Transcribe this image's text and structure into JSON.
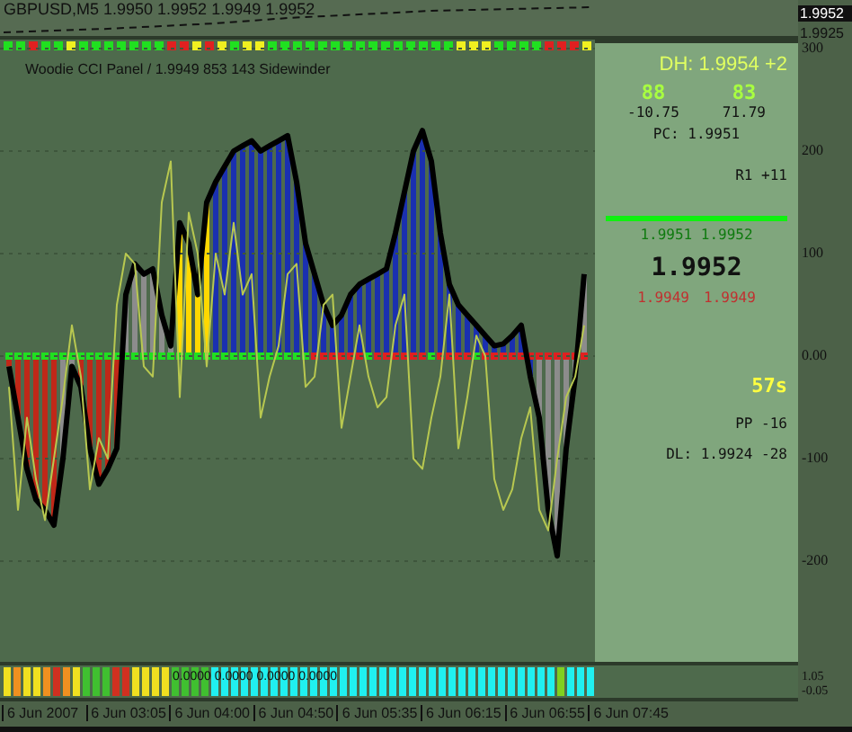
{
  "price_panel": {
    "title": "GBPUSD,M5  1.9950 1.9952 1.9949 1.9952",
    "scale": [
      {
        "label": "1.9952",
        "selected": true
      },
      {
        "label": "1.9925",
        "selected": false
      }
    ]
  },
  "indicator_label": "Woodie CCI Panel / 1.9949 853 143  Sidewinder",
  "trend_dots": [
    {
      "color": "#20e020"
    },
    {
      "color": "#20e020"
    },
    {
      "color": "#e02020"
    },
    {
      "color": "#20e020"
    },
    {
      "color": "#20e020"
    },
    {
      "color": "#f0f020"
    },
    {
      "color": "#20e020"
    },
    {
      "color": "#20e020"
    },
    {
      "color": "#20e020"
    },
    {
      "color": "#20e020"
    },
    {
      "color": "#20e020"
    },
    {
      "color": "#20e020"
    },
    {
      "color": "#20e020"
    },
    {
      "color": "#e02020"
    },
    {
      "color": "#e02020"
    },
    {
      "color": "#f0f020"
    },
    {
      "color": "#e02020"
    },
    {
      "color": "#f0f020"
    },
    {
      "color": "#20e020"
    },
    {
      "color": "#f0f020"
    },
    {
      "color": "#f0f020"
    },
    {
      "color": "#20e020"
    },
    {
      "color": "#20e020"
    },
    {
      "color": "#20e020"
    },
    {
      "color": "#20e020"
    },
    {
      "color": "#20e020"
    },
    {
      "color": "#20e020"
    },
    {
      "color": "#20e020"
    },
    {
      "color": "#20e020"
    },
    {
      "color": "#20e020"
    },
    {
      "color": "#20e020"
    },
    {
      "color": "#20e020"
    },
    {
      "color": "#20e020"
    },
    {
      "color": "#20e020"
    },
    {
      "color": "#20e020"
    },
    {
      "color": "#20e020"
    },
    {
      "color": "#f0f020"
    },
    {
      "color": "#f0f020"
    },
    {
      "color": "#f0f020"
    },
    {
      "color": "#20e020"
    },
    {
      "color": "#20e020"
    },
    {
      "color": "#20e020"
    },
    {
      "color": "#20e020"
    },
    {
      "color": "#e02020"
    },
    {
      "color": "#e02020"
    },
    {
      "color": "#e02020"
    },
    {
      "color": "#f0f020"
    }
  ],
  "chart_data": {
    "type": "line",
    "grid": true,
    "ylim": [
      -300,
      300
    ],
    "yticks": [
      300,
      200,
      100,
      {
        "value": 0,
        "label": "0.00"
      },
      -100,
      -200
    ],
    "series": [
      {
        "color": "#000000",
        "values": [
          -10,
          -60,
          -110,
          -140,
          -150,
          -165,
          -100,
          -10,
          -30,
          -90,
          -125,
          -110,
          -90,
          60,
          90,
          80,
          85,
          40,
          10,
          130,
          110,
          60,
          150,
          170,
          185,
          200,
          205,
          210,
          200,
          205,
          210,
          215,
          170,
          110,
          80,
          50,
          30,
          40,
          60,
          70,
          75,
          80,
          85,
          120,
          160,
          200,
          220,
          190,
          120,
          70,
          50,
          40,
          30,
          20,
          10,
          12,
          20,
          30,
          -20,
          -60,
          -150,
          -195,
          -90,
          -20,
          80
        ]
      },
      {
        "color": "#b8c850",
        "values": [
          -30,
          -150,
          -60,
          -120,
          -160,
          -100,
          -40,
          30,
          -20,
          -130,
          -80,
          -100,
          50,
          100,
          90,
          -10,
          -20,
          150,
          190,
          -40,
          140,
          100,
          -10,
          100,
          60,
          130,
          60,
          80,
          -60,
          -20,
          10,
          80,
          90,
          -30,
          -20,
          50,
          60,
          -70,
          -20,
          30,
          -20,
          -50,
          -40,
          30,
          60,
          -100,
          -110,
          -60,
          -20,
          60,
          -90,
          -40,
          20,
          0,
          -120,
          -150,
          -130,
          -80,
          -50,
          -150,
          -170,
          -100,
          -40,
          -20,
          30
        ]
      }
    ]
  },
  "histogram": [
    {
      "color": "#c02818"
    },
    {
      "color": "#c02818"
    },
    {
      "color": "#c02818"
    },
    {
      "color": "#c02818"
    },
    {
      "color": "#c02818"
    },
    {
      "color": "#c02818"
    },
    {
      "color": "#8c8c8c"
    },
    {
      "color": "#8c8c8c"
    },
    {
      "color": "#c02818"
    },
    {
      "color": "#c02818"
    },
    {
      "color": "#c02818"
    },
    {
      "color": "#c02818"
    },
    {
      "color": "#c02818"
    },
    {
      "color": "#8c8c8c"
    },
    {
      "color": "#8c8c8c"
    },
    {
      "color": "#8c8c8c"
    },
    {
      "color": "#8c8c8c"
    },
    {
      "color": "#8c8c8c"
    },
    {
      "color": "#8c8c8c"
    },
    {
      "color": "#ffd800"
    },
    {
      "color": "#ffd800"
    },
    {
      "color": "#ffd800"
    },
    {
      "color": "#ffd800"
    },
    {
      "color": "#1a30b0"
    },
    {
      "color": "#1a30b0"
    },
    {
      "color": "#1a30b0"
    },
    {
      "color": "#1a30b0"
    },
    {
      "color": "#1a30b0"
    },
    {
      "color": "#1a30b0"
    },
    {
      "color": "#1a30b0"
    },
    {
      "color": "#1a30b0"
    },
    {
      "color": "#1a30b0"
    },
    {
      "color": "#1a30b0"
    },
    {
      "color": "#1a30b0"
    },
    {
      "color": "#1a30b0"
    },
    {
      "color": "#1a30b0"
    },
    {
      "color": "#1a30b0"
    },
    {
      "color": "#1a30b0"
    },
    {
      "color": "#1a30b0"
    },
    {
      "color": "#1a30b0"
    },
    {
      "color": "#1a30b0"
    },
    {
      "color": "#1a30b0"
    },
    {
      "color": "#1a30b0"
    },
    {
      "color": "#1a30b0"
    },
    {
      "color": "#1a30b0"
    },
    {
      "color": "#1a30b0"
    },
    {
      "color": "#1a30b0"
    },
    {
      "color": "#1a30b0"
    },
    {
      "color": "#1a30b0"
    },
    {
      "color": "#1a30b0"
    },
    {
      "color": "#1a30b0"
    },
    {
      "color": "#1a30b0"
    },
    {
      "color": "#1a30b0"
    },
    {
      "color": "#1a30b0"
    },
    {
      "color": "#1a30b0"
    },
    {
      "color": "#1a30b0"
    },
    {
      "color": "#1a30b0"
    },
    {
      "color": "#1a30b0"
    },
    {
      "color": "#1a30b0"
    },
    {
      "color": "#8c8c8c"
    },
    {
      "color": "#8c8c8c"
    },
    {
      "color": "#8c8c8c"
    },
    {
      "color": "#8c8c8c"
    },
    {
      "color": "#8c8c8c"
    },
    {
      "color": "#8c8c8c"
    }
  ],
  "zero_dots": [
    {
      "color": "#20e020"
    },
    {
      "color": "#20e020"
    },
    {
      "color": "#20e020"
    },
    {
      "color": "#20e020"
    },
    {
      "color": "#20e020"
    },
    {
      "color": "#20e020"
    },
    {
      "color": "#20e020"
    },
    {
      "color": "#20e020"
    },
    {
      "color": "#20e020"
    },
    {
      "color": "#20e020"
    },
    {
      "color": "#20e020"
    },
    {
      "color": "#20e020"
    },
    {
      "color": "#20e020"
    },
    {
      "color": "#20e020"
    },
    {
      "color": "#20e020"
    },
    {
      "color": "#20e020"
    },
    {
      "color": "#20e020"
    },
    {
      "color": "#20e020"
    },
    {
      "color": "#20e020"
    },
    {
      "color": "#20e020"
    },
    {
      "color": "#20e020"
    },
    {
      "color": "#20e020"
    },
    {
      "color": "#20e020"
    },
    {
      "color": "#20e020"
    },
    {
      "color": "#20e020"
    },
    {
      "color": "#20e020"
    },
    {
      "color": "#20e020"
    },
    {
      "color": "#20e020"
    },
    {
      "color": "#20e020"
    },
    {
      "color": "#20e020"
    },
    {
      "color": "#20e020"
    },
    {
      "color": "#20e020"
    },
    {
      "color": "#20e020"
    },
    {
      "color": "#20e020"
    },
    {
      "color": "#e02020"
    },
    {
      "color": "#e02020"
    },
    {
      "color": "#e02020"
    },
    {
      "color": "#e02020"
    },
    {
      "color": "#e02020"
    },
    {
      "color": "#e02020"
    },
    {
      "color": "#20e020"
    },
    {
      "color": "#e02020"
    },
    {
      "color": "#e02020"
    },
    {
      "color": "#e02020"
    },
    {
      "color": "#e02020"
    },
    {
      "color": "#e02020"
    },
    {
      "color": "#e02020"
    },
    {
      "color": "#20e020"
    },
    {
      "color": "#e02020"
    },
    {
      "color": "#e02020"
    },
    {
      "color": "#e02020"
    },
    {
      "color": "#e02020"
    },
    {
      "color": "#20e020"
    },
    {
      "color": "#e02020"
    },
    {
      "color": "#e02020"
    },
    {
      "color": "#e02020"
    },
    {
      "color": "#e02020"
    },
    {
      "color": "#e02020"
    },
    {
      "color": "#e02020"
    },
    {
      "color": "#e02020"
    },
    {
      "color": "#e02020"
    },
    {
      "color": "#e02020"
    },
    {
      "color": "#e02020"
    },
    {
      "color": "#e02020"
    },
    {
      "color": "#e02020"
    }
  ],
  "info_panel": {
    "day_high": "DH: 1.9954 +2",
    "readings": [
      {
        "value": "88",
        "change": "-10.75"
      },
      {
        "value": "83",
        "change": "71.79"
      }
    ],
    "previous_close": "PC: 1.9951",
    "r1": "R1 +11",
    "faded": "1.9951 1.9952",
    "price": "1.9952",
    "bid_ask": [
      "1.9949",
      "1.9949"
    ],
    "timer": "57s",
    "pivot": "PP -16",
    "day_low": "DL: 1.9924 -28"
  },
  "bottom_panel": {
    "text": "0.0000 0.0000 0.0000 0.0000",
    "scale": [
      "1.05",
      "-0.05"
    ],
    "bars": [
      {
        "color": "#f0e020"
      },
      {
        "color": "#f09020"
      },
      {
        "color": "#f0e020"
      },
      {
        "color": "#f0e020"
      },
      {
        "color": "#f09020"
      },
      {
        "color": "#d03020"
      },
      {
        "color": "#f09020"
      },
      {
        "color": "#f0e020"
      },
      {
        "color": "#40c030"
      },
      {
        "color": "#40c030"
      },
      {
        "color": "#40c030"
      },
      {
        "color": "#d03020"
      },
      {
        "color": "#d03020"
      },
      {
        "color": "#f0e020"
      },
      {
        "color": "#f0e020"
      },
      {
        "color": "#f0e020"
      },
      {
        "color": "#f0e020"
      },
      {
        "color": "#40c030"
      },
      {
        "color": "#40c030"
      },
      {
        "color": "#40c030"
      },
      {
        "color": "#40c030"
      },
      {
        "color": "#20f0f0"
      },
      {
        "color": "#20f0f0"
      },
      {
        "color": "#20f0f0"
      },
      {
        "color": "#20f0f0"
      },
      {
        "color": "#20f0f0"
      },
      {
        "color": "#20f0f0"
      },
      {
        "color": "#20f0f0"
      },
      {
        "color": "#20f0f0"
      },
      {
        "color": "#20f0f0"
      },
      {
        "color": "#20f0f0"
      },
      {
        "color": "#20f0f0"
      },
      {
        "color": "#20f0f0"
      },
      {
        "color": "#20f0f0"
      },
      {
        "color": "#20f0f0"
      },
      {
        "color": "#20f0f0"
      },
      {
        "color": "#20f0f0"
      },
      {
        "color": "#20f0f0"
      },
      {
        "color": "#20f0f0"
      },
      {
        "color": "#20f0f0"
      },
      {
        "color": "#20f0f0"
      },
      {
        "color": "#20f0f0"
      },
      {
        "color": "#20f0f0"
      },
      {
        "color": "#20f0f0"
      },
      {
        "color": "#20f0f0"
      },
      {
        "color": "#20f0f0"
      },
      {
        "color": "#20f0f0"
      },
      {
        "color": "#20f0f0"
      },
      {
        "color": "#20f0f0"
      },
      {
        "color": "#20f0f0"
      },
      {
        "color": "#20f0f0"
      },
      {
        "color": "#20f0f0"
      },
      {
        "color": "#20f0f0"
      },
      {
        "color": "#20f0f0"
      },
      {
        "color": "#20f0f0"
      },
      {
        "color": "#20f0f0"
      },
      {
        "color": "#80d020"
      },
      {
        "color": "#20f0f0"
      },
      {
        "color": "#20f0f0"
      },
      {
        "color": "#20f0f0"
      }
    ]
  },
  "time_axis": [
    "6 Jun 2007",
    "6 Jun 03:05",
    "6 Jun 04:00",
    "6 Jun 04:50",
    "6 Jun 05:35",
    "6 Jun 06:15",
    "6 Jun 06:55",
    "6 Jun 07:45"
  ]
}
